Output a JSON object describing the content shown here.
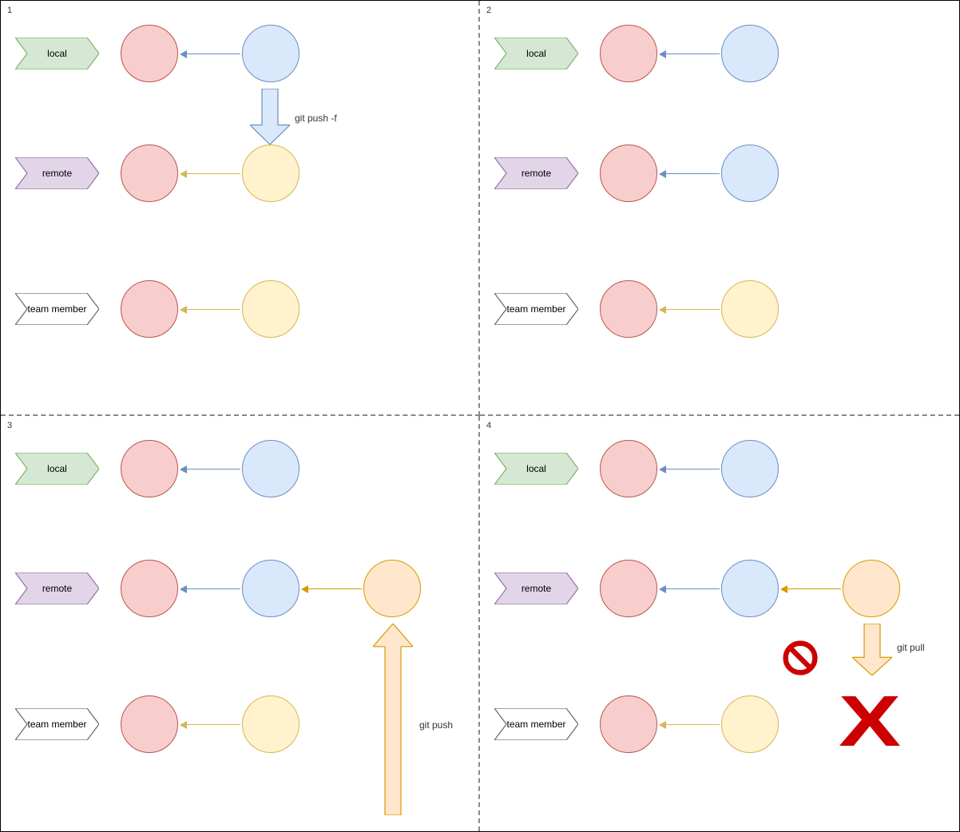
{
  "panels": [
    {
      "number": "1",
      "rows": [
        {
          "tag": "local",
          "tag_color": "green",
          "commits": [
            "red",
            "blue"
          ],
          "arrow_color": "blue"
        },
        {
          "tag": "remote",
          "tag_color": "purple",
          "commits": [
            "red",
            "yellow"
          ],
          "arrow_color": "yellow"
        },
        {
          "tag": "team member",
          "tag_color": "white",
          "commits": [
            "red",
            "yellow"
          ],
          "arrow_color": "yellow"
        }
      ],
      "action": {
        "type": "down_arrow_thick",
        "fill": "blue",
        "label": "git push -f"
      }
    },
    {
      "number": "2",
      "rows": [
        {
          "tag": "local",
          "tag_color": "green",
          "commits": [
            "red",
            "blue"
          ],
          "arrow_color": "blue"
        },
        {
          "tag": "remote",
          "tag_color": "purple",
          "commits": [
            "red",
            "blue"
          ],
          "arrow_color": "blue"
        },
        {
          "tag": "team member",
          "tag_color": "white",
          "commits": [
            "red",
            "yellow"
          ],
          "arrow_color": "yellow"
        }
      ]
    },
    {
      "number": "3",
      "rows": [
        {
          "tag": "local",
          "tag_color": "green",
          "commits": [
            "red",
            "blue"
          ],
          "arrow_color": "blue"
        },
        {
          "tag": "remote",
          "tag_color": "purple",
          "commits": [
            "red",
            "blue",
            "orange"
          ],
          "arrow_color": "orange",
          "arrow2_color": "blue"
        },
        {
          "tag": "team member",
          "tag_color": "white",
          "commits": [
            "red",
            "yellow"
          ],
          "arrow_color": "yellow"
        }
      ],
      "action": {
        "type": "up_arrow_thick",
        "fill": "orange",
        "label": "git push"
      }
    },
    {
      "number": "4",
      "rows": [
        {
          "tag": "local",
          "tag_color": "green",
          "commits": [
            "red",
            "blue"
          ],
          "arrow_color": "blue"
        },
        {
          "tag": "remote",
          "tag_color": "purple",
          "commits": [
            "red",
            "blue",
            "orange"
          ],
          "arrow_color": "orange",
          "arrow2_color": "blue"
        },
        {
          "tag": "team member",
          "tag_color": "white",
          "commits": [
            "red",
            "yellow"
          ],
          "arrow_color": "yellow"
        }
      ],
      "action": {
        "type": "down_arrow_thick_small",
        "fill": "orange",
        "label": "git pull",
        "prohibit": true,
        "big_x": true
      }
    }
  ],
  "tag_colors": {
    "green": {
      "fill": "#d5e8d4",
      "stroke": "#82b366"
    },
    "purple": {
      "fill": "#e1d5e7",
      "stroke": "#9673a6"
    },
    "white": {
      "fill": "#ffffff",
      "stroke": "#666666"
    }
  },
  "fill_colors": {
    "blue": {
      "fill": "#dae8fc",
      "stroke": "#6c8ebf"
    },
    "orange": {
      "fill": "#ffe6cc",
      "stroke": "#d79b00"
    }
  }
}
